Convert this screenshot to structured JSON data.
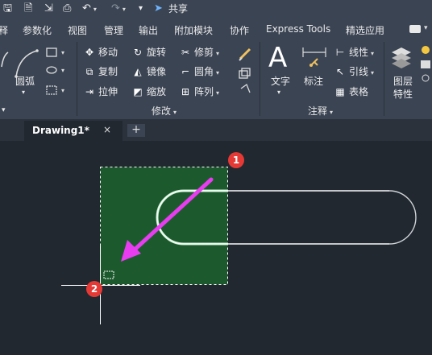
{
  "quick_access": {
    "share_label": "共享",
    "icons": [
      "save-icon",
      "saveas-icon",
      "export-icon",
      "print-icon",
      "undo-icon",
      "redo-icon",
      "more-icon",
      "share-icon"
    ]
  },
  "ribbon_tabs": [
    "释",
    "参数化",
    "视图",
    "管理",
    "输出",
    "附加模块",
    "协作",
    "Express Tools",
    "精选应用"
  ],
  "ribbon": {
    "draw": {
      "arc_label": "圆弧"
    },
    "modify": {
      "title": "修改",
      "tools": [
        {
          "label": "移动",
          "icon": "move-icon"
        },
        {
          "label": "旋转",
          "icon": "rotate-icon"
        },
        {
          "label": "修剪",
          "icon": "trim-icon"
        },
        {
          "label": "复制",
          "icon": "copy-icon"
        },
        {
          "label": "镜像",
          "icon": "mirror-icon"
        },
        {
          "label": "圆角",
          "icon": "fillet-icon"
        },
        {
          "label": "拉伸",
          "icon": "stretch-icon"
        },
        {
          "label": "缩放",
          "icon": "scale-icon"
        },
        {
          "label": "阵列",
          "icon": "array-icon"
        }
      ]
    },
    "annotation": {
      "title": "注释",
      "text_label": "文字",
      "dim_label": "标注",
      "linear_label": "线性",
      "leader_label": "引线",
      "table_label": "表格"
    },
    "layers": {
      "props_line1": "图层",
      "props_line2": "特性"
    }
  },
  "document": {
    "tab_title": "Drawing1*",
    "close_glyph": "×",
    "new_tab_glyph": "+"
  },
  "markers": {
    "first": "1",
    "second": "2"
  },
  "colors": {
    "canvas_bg": "#212830",
    "selection_fill": "#1c5e2f",
    "arrow": "#e83cf0",
    "badge": "#e53935"
  }
}
